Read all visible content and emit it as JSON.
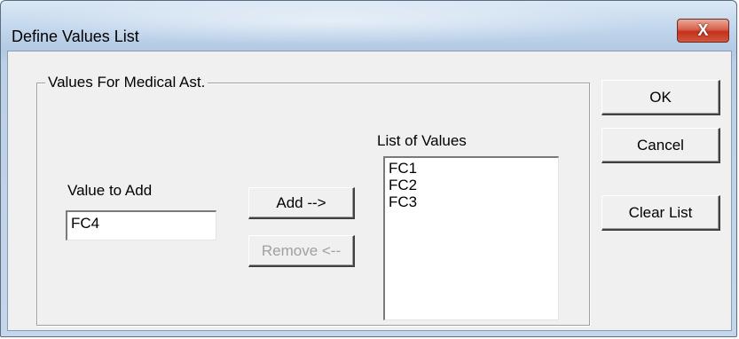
{
  "window": {
    "title": "Define Values List",
    "close_label": "X"
  },
  "group": {
    "label": "Values For Medical Ast."
  },
  "value_to_add": {
    "label": "Value to Add",
    "value": "FC4"
  },
  "buttons": {
    "add": "Add -->",
    "remove": "Remove <--",
    "ok": "OK",
    "cancel": "Cancel",
    "clear_list": "Clear List"
  },
  "list_of_values": {
    "label": "List of Values",
    "items": [
      "FC1",
      "FC2",
      "FC3"
    ]
  }
}
